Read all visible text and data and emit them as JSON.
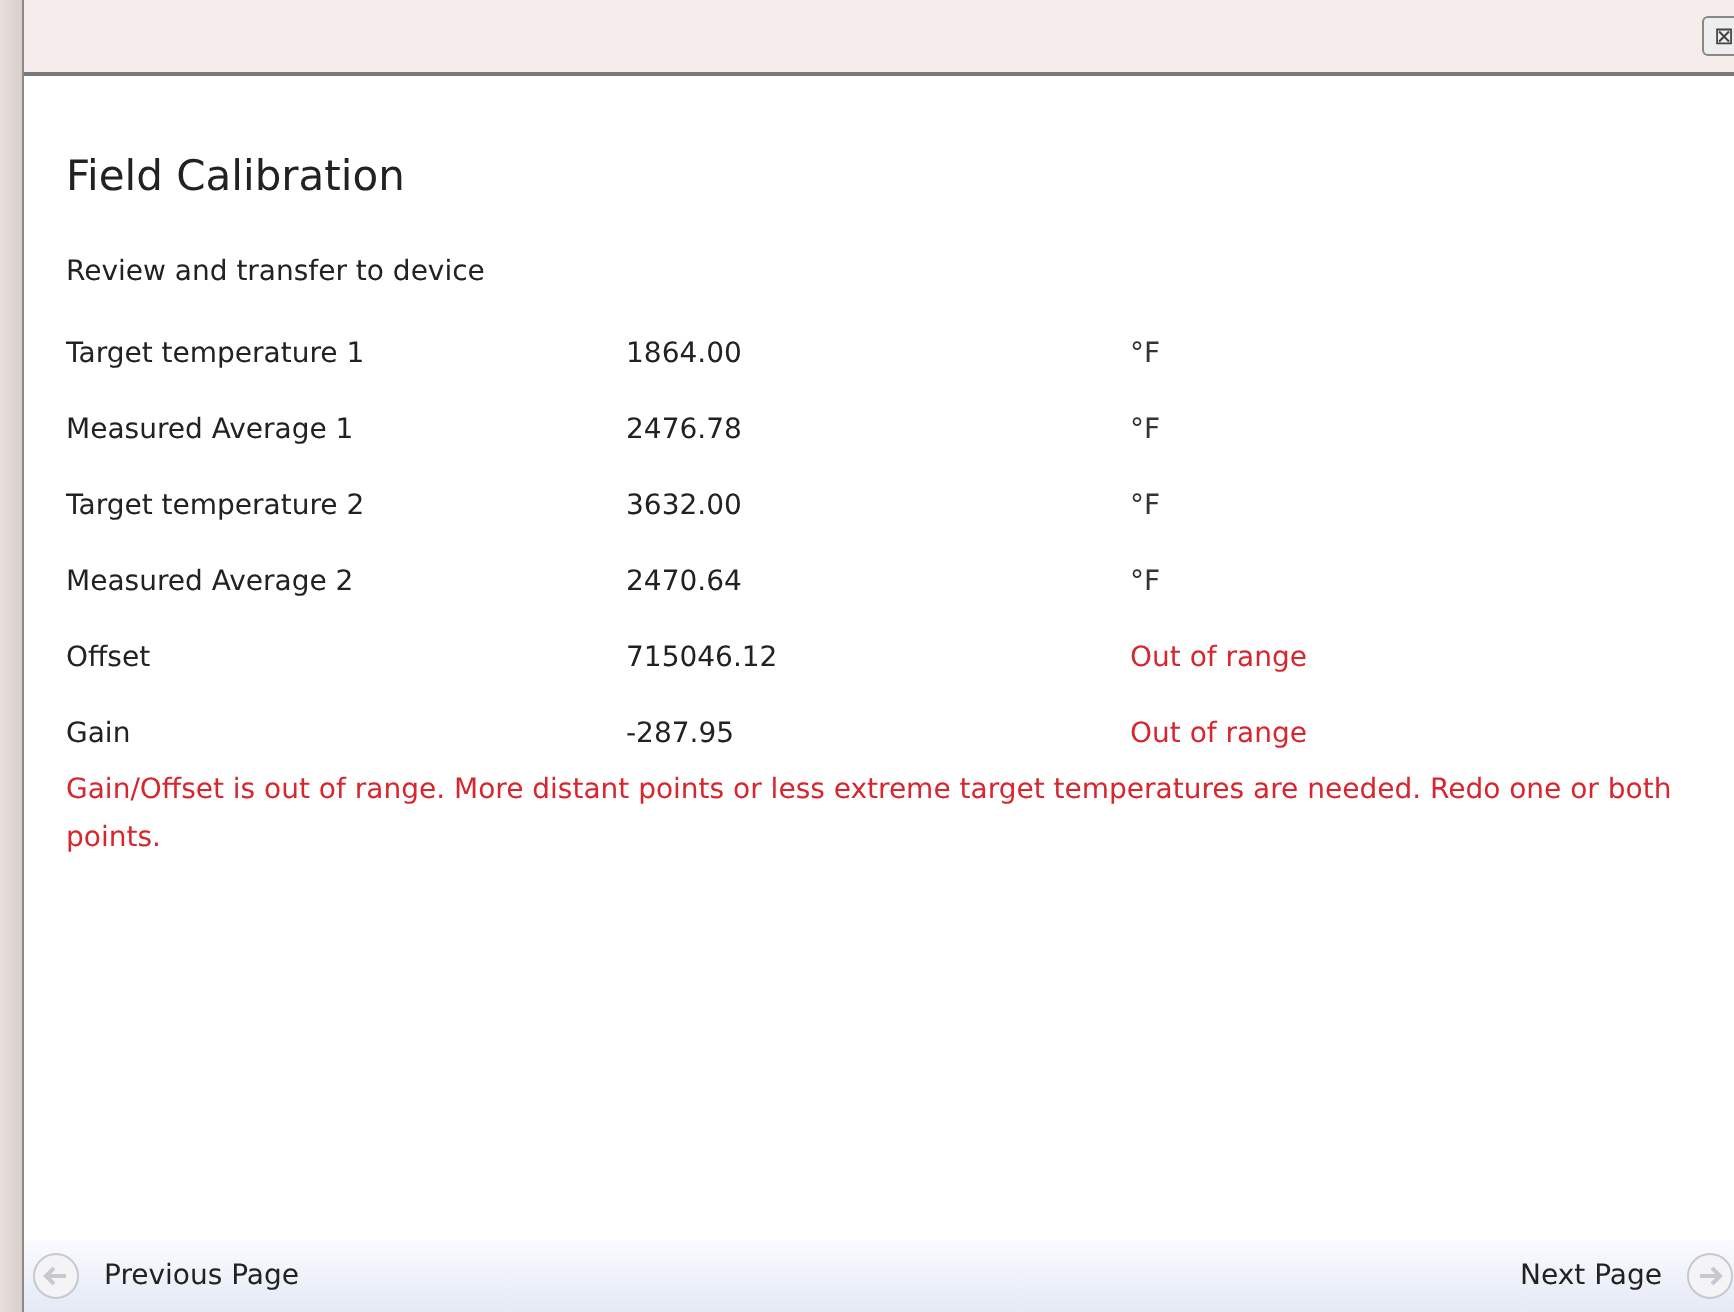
{
  "window": {
    "close_button": "⊠"
  },
  "title": "Field Calibration",
  "subtitle": "Review and transfer to device",
  "rows": [
    {
      "label": "Target temperature 1",
      "value": "1864.00",
      "unit": "°F",
      "kind": "normal"
    },
    {
      "label": "Measured Average 1",
      "value": "2476.78",
      "unit": "°F",
      "kind": "normal"
    },
    {
      "label": "Target temperature 2",
      "value": "3632.00",
      "unit": "°F",
      "kind": "normal"
    },
    {
      "label": "Measured Average 2",
      "value": "2470.64",
      "unit": "°F",
      "kind": "normal"
    },
    {
      "label": "Offset",
      "value": "715046.12",
      "unit": "Out of range",
      "kind": "error"
    },
    {
      "label": "Gain",
      "value": "-287.95",
      "unit": "Out of range",
      "kind": "error"
    }
  ],
  "error_message": "Gain/Offset is out of range. More distant points or less extreme target temperatures are needed. Redo one or both points.",
  "nav": {
    "previous": "Previous Page",
    "next": "Next Page"
  }
}
